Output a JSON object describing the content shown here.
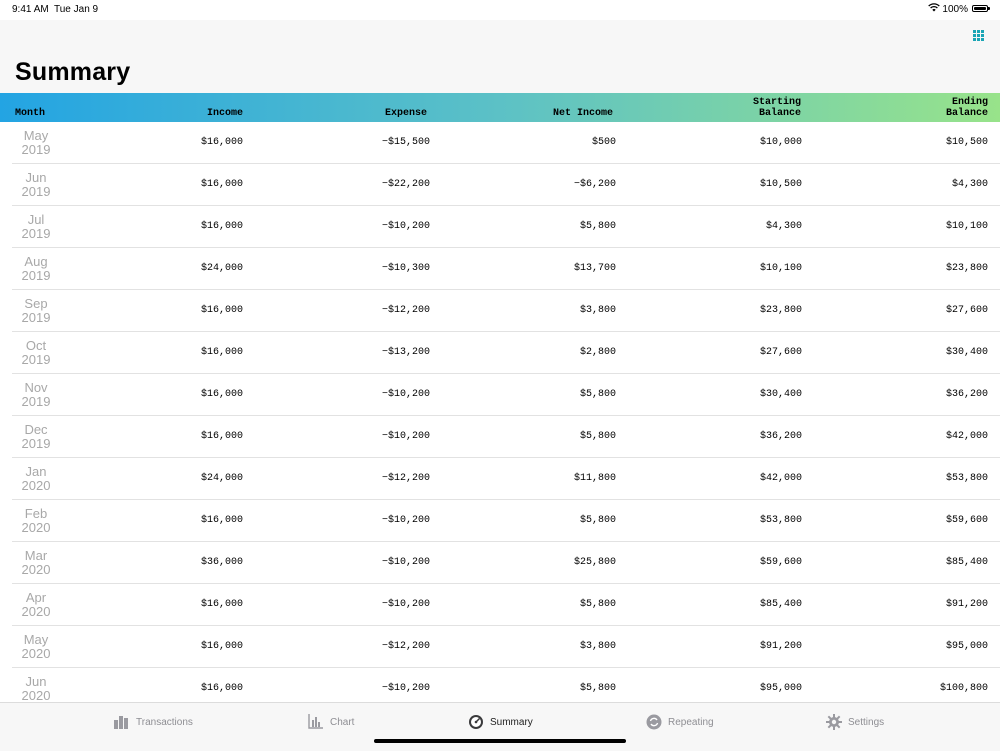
{
  "status": {
    "time": "9:41 AM",
    "date": "Tue Jan 9",
    "battery": "100%"
  },
  "page": {
    "title": "Summary"
  },
  "table": {
    "columns": [
      "Month",
      "Income",
      "Expense",
      "Net Income",
      "Starting\nBalance",
      "Ending\nBalance"
    ],
    "rows": [
      {
        "month": "May\n2019",
        "income": "$16,000",
        "expense": "−$15,500",
        "net": "$500",
        "start": "$10,000",
        "end": "$10,500"
      },
      {
        "month": "Jun\n2019",
        "income": "$16,000",
        "expense": "−$22,200",
        "net": "−$6,200",
        "start": "$10,500",
        "end": "$4,300"
      },
      {
        "month": "Jul\n2019",
        "income": "$16,000",
        "expense": "−$10,200",
        "net": "$5,800",
        "start": "$4,300",
        "end": "$10,100"
      },
      {
        "month": "Aug\n2019",
        "income": "$24,000",
        "expense": "−$10,300",
        "net": "$13,700",
        "start": "$10,100",
        "end": "$23,800"
      },
      {
        "month": "Sep\n2019",
        "income": "$16,000",
        "expense": "−$12,200",
        "net": "$3,800",
        "start": "$23,800",
        "end": "$27,600"
      },
      {
        "month": "Oct\n2019",
        "income": "$16,000",
        "expense": "−$13,200",
        "net": "$2,800",
        "start": "$27,600",
        "end": "$30,400"
      },
      {
        "month": "Nov\n2019",
        "income": "$16,000",
        "expense": "−$10,200",
        "net": "$5,800",
        "start": "$30,400",
        "end": "$36,200"
      },
      {
        "month": "Dec\n2019",
        "income": "$16,000",
        "expense": "−$10,200",
        "net": "$5,800",
        "start": "$36,200",
        "end": "$42,000"
      },
      {
        "month": "Jan\n2020",
        "income": "$24,000",
        "expense": "−$12,200",
        "net": "$11,800",
        "start": "$42,000",
        "end": "$53,800"
      },
      {
        "month": "Feb\n2020",
        "income": "$16,000",
        "expense": "−$10,200",
        "net": "$5,800",
        "start": "$53,800",
        "end": "$59,600"
      },
      {
        "month": "Mar\n2020",
        "income": "$36,000",
        "expense": "−$10,200",
        "net": "$25,800",
        "start": "$59,600",
        "end": "$85,400"
      },
      {
        "month": "Apr\n2020",
        "income": "$16,000",
        "expense": "−$10,200",
        "net": "$5,800",
        "start": "$85,400",
        "end": "$91,200"
      },
      {
        "month": "May\n2020",
        "income": "$16,000",
        "expense": "−$12,200",
        "net": "$3,800",
        "start": "$91,200",
        "end": "$95,000"
      },
      {
        "month": "Jun\n2020",
        "income": "$16,000",
        "expense": "−$10,200",
        "net": "$5,800",
        "start": "$95,000",
        "end": "$100,800"
      }
    ]
  },
  "tabs": [
    {
      "label": "Transactions",
      "icon": "bar-stack-icon",
      "active": false
    },
    {
      "label": "Chart",
      "icon": "chart-icon",
      "active": false
    },
    {
      "label": "Summary",
      "icon": "gauge-icon",
      "active": true
    },
    {
      "label": "Repeating",
      "icon": "repeat-icon",
      "active": false
    },
    {
      "label": "Settings",
      "icon": "gear-icon",
      "active": false
    }
  ],
  "colors": {
    "accent": "#1aa5b5",
    "header_start": "#23a4e3",
    "header_end": "#98e38a"
  }
}
